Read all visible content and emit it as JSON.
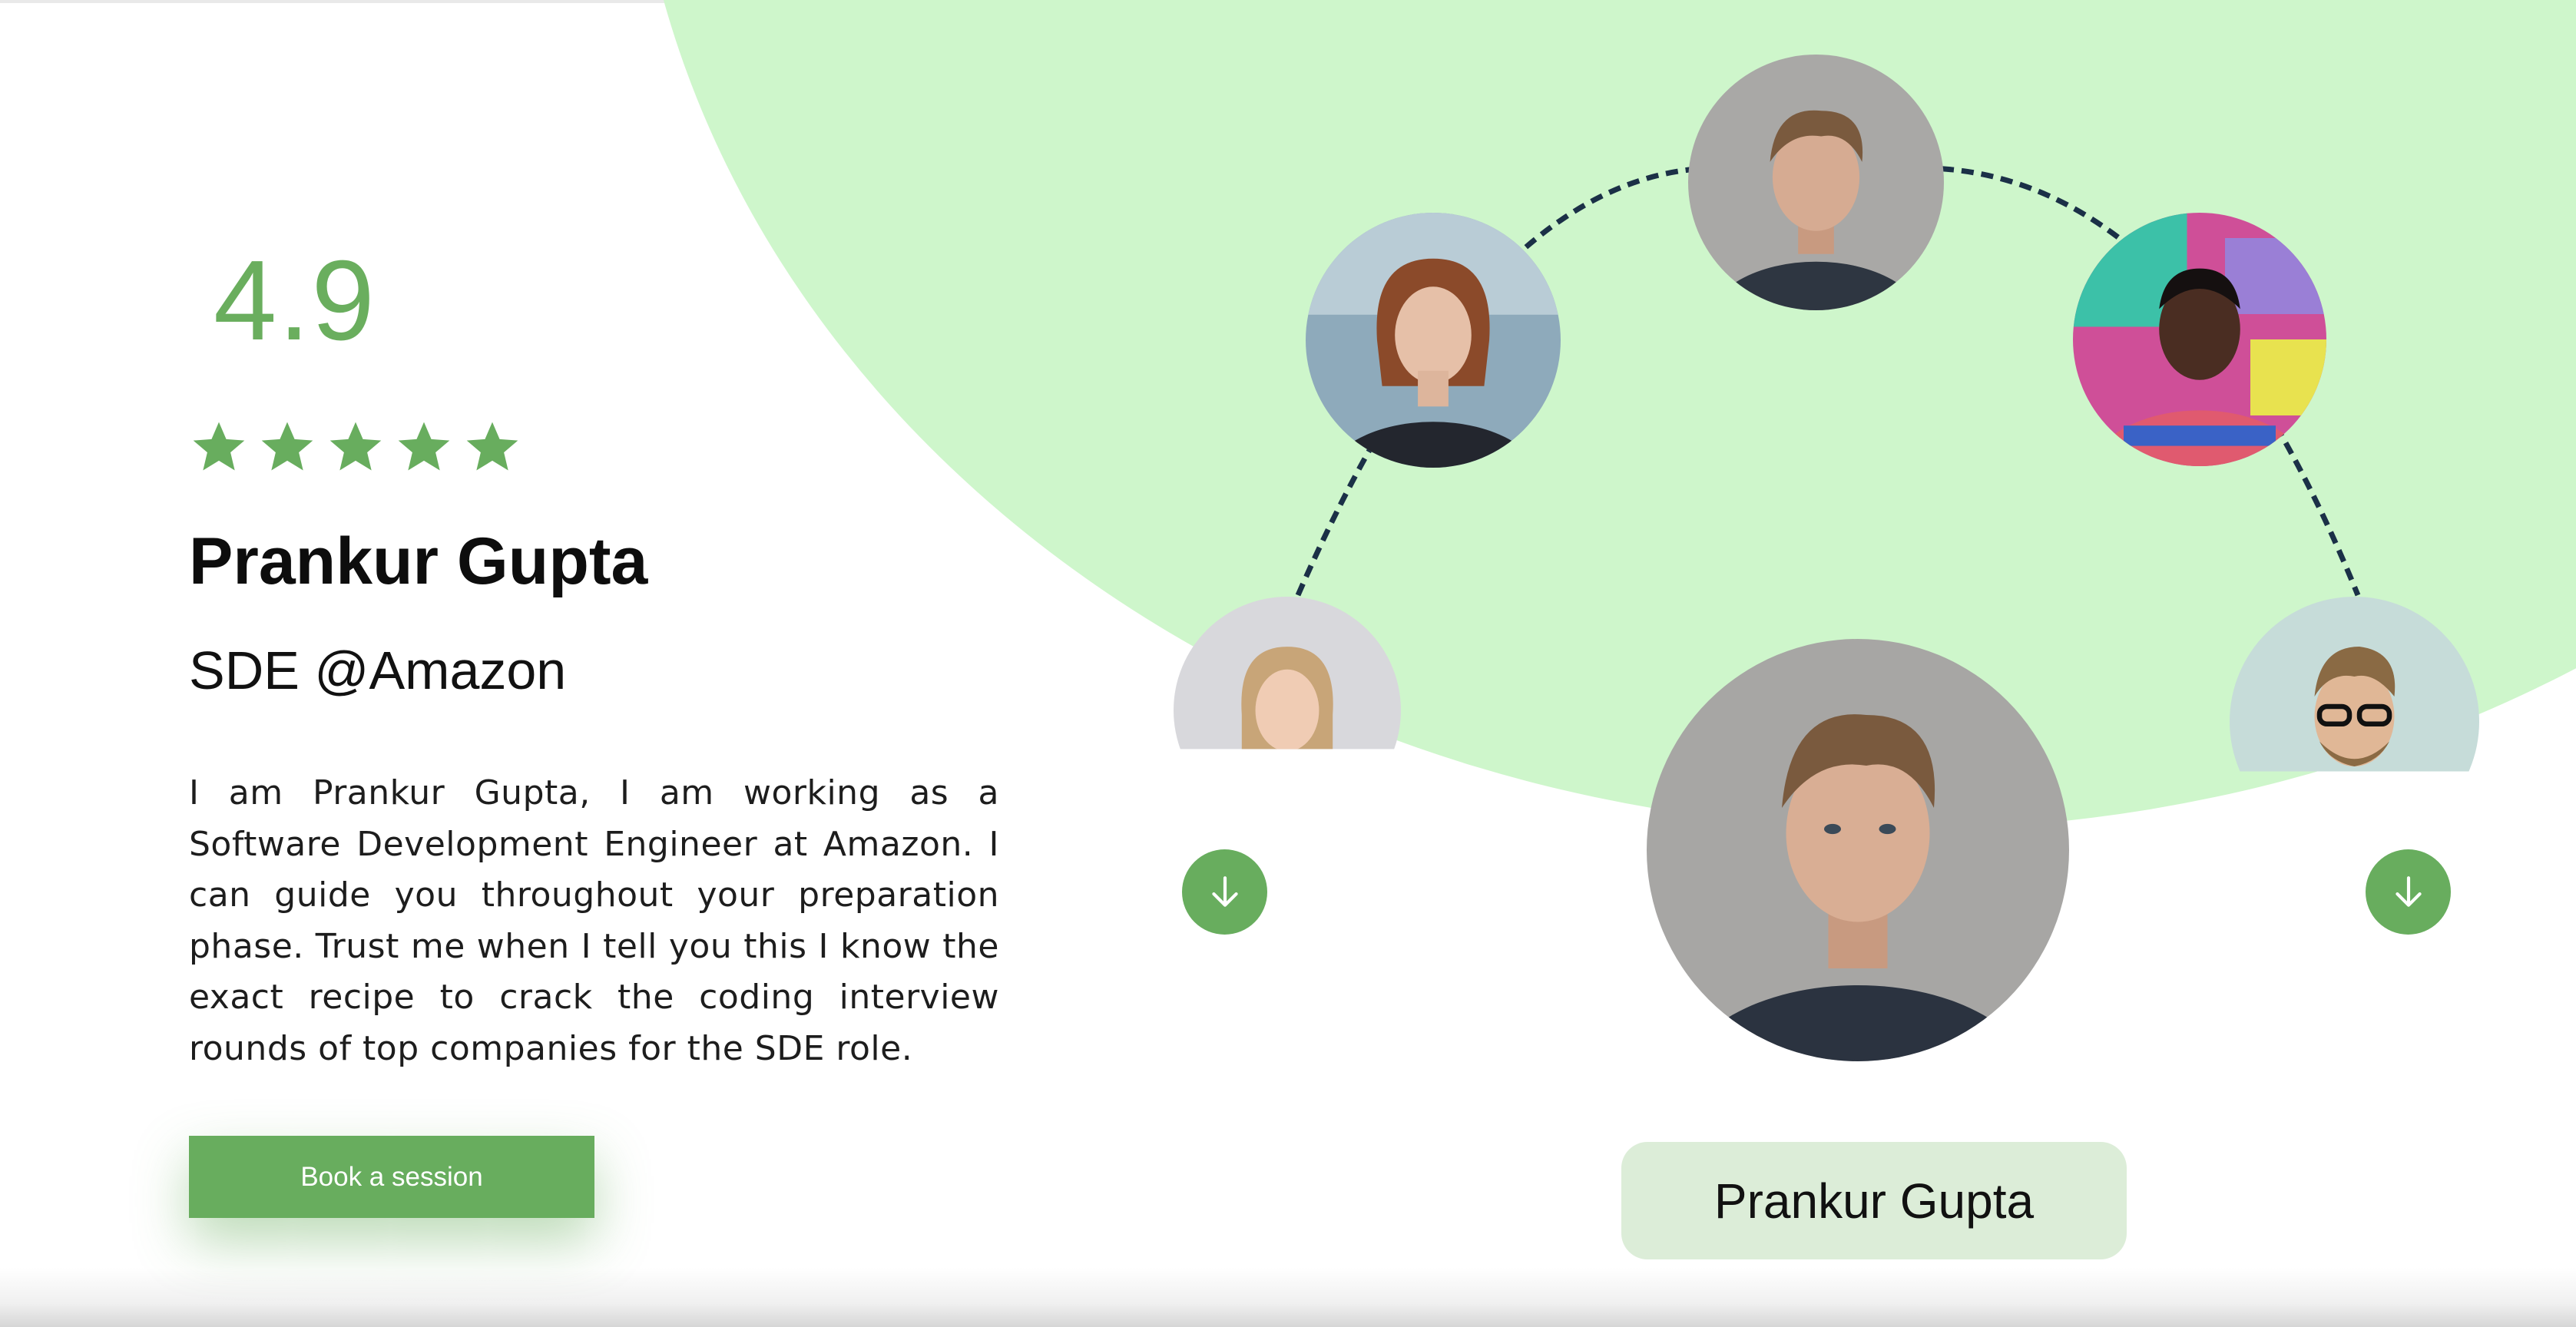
{
  "profile": {
    "rating": "4.9",
    "stars": 5,
    "name": "Prankur Gupta",
    "role": "SDE @Amazon",
    "bio": "I am Prankur Gupta, I am working as a Software Development Engineer at Amazon. I can guide you throughout your preparation phase. Trust me when I tell you this I know the exact recipe to crack the coding interview rounds of top companies for the SDE role.",
    "cta_label": "Book a session"
  },
  "carousel": {
    "selected_name": "Prankur Gupta",
    "prev_icon": "arrow-down-icon",
    "next_icon": "arrow-down-icon"
  },
  "colors": {
    "accent": "#68ad5e",
    "bg_blob": "#cef6cb",
    "name_pill": "#dcedd8",
    "dashed_path": "#1b3047"
  }
}
